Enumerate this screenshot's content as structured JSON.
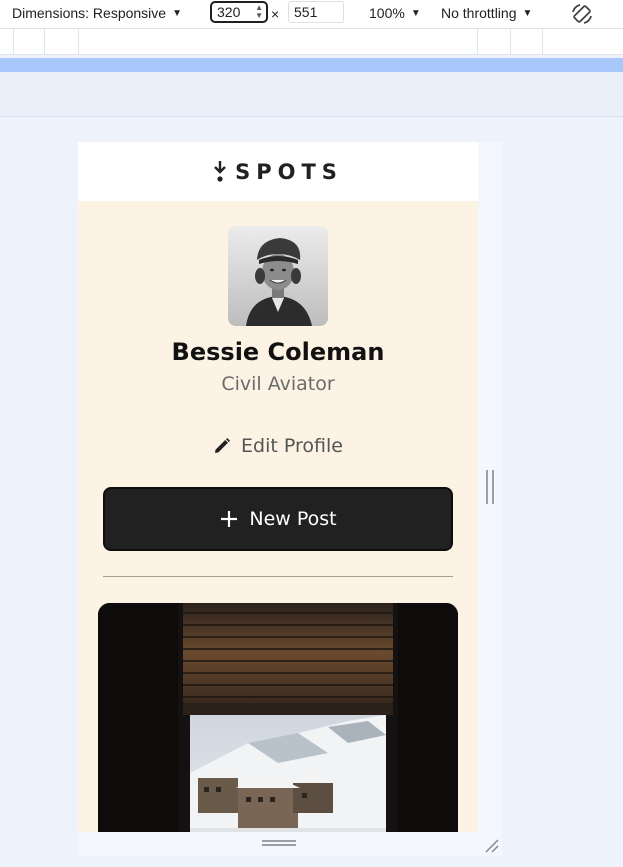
{
  "toolbar": {
    "dimensions_label": "Dimensions: Responsive",
    "width_value": "320",
    "height_value": "551",
    "times_symbol": "×",
    "zoom_label": "100%",
    "throttle_label": "No throttling",
    "rotate_icon": "rotate-icon"
  },
  "page": {
    "brand": "SPOTS",
    "profile": {
      "name": "Bessie Coleman",
      "role": "Civil Aviator",
      "avatar_icon": "avatar-photo"
    },
    "edit_label": "Edit Profile",
    "new_post_label": "New Post"
  },
  "colors": {
    "page_background": "#fcf3e5",
    "header_background": "#ffffff",
    "button_background": "#212121",
    "button_text": "#ffffff",
    "media_query_bar": "#a8c7fa"
  }
}
